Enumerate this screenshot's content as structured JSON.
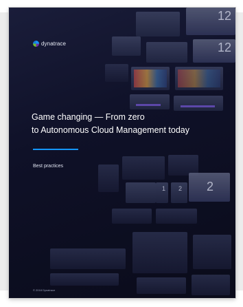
{
  "brand": {
    "logo_text": "dynatrace",
    "colors": {
      "blue": "#1496ff",
      "purple": "#6f2da8",
      "green": "#73be28"
    }
  },
  "cover": {
    "title_line1": "Game changing — From zero",
    "title_line2": "to Autonomous Cloud Management today",
    "subtitle": "Best practices",
    "footer": "© 2018 Dynatrace",
    "accent_color": "#1496ff",
    "background_color": "#0f1128"
  },
  "tiles": {
    "numbers": [
      "12",
      "12",
      "2",
      "1",
      "2"
    ]
  }
}
